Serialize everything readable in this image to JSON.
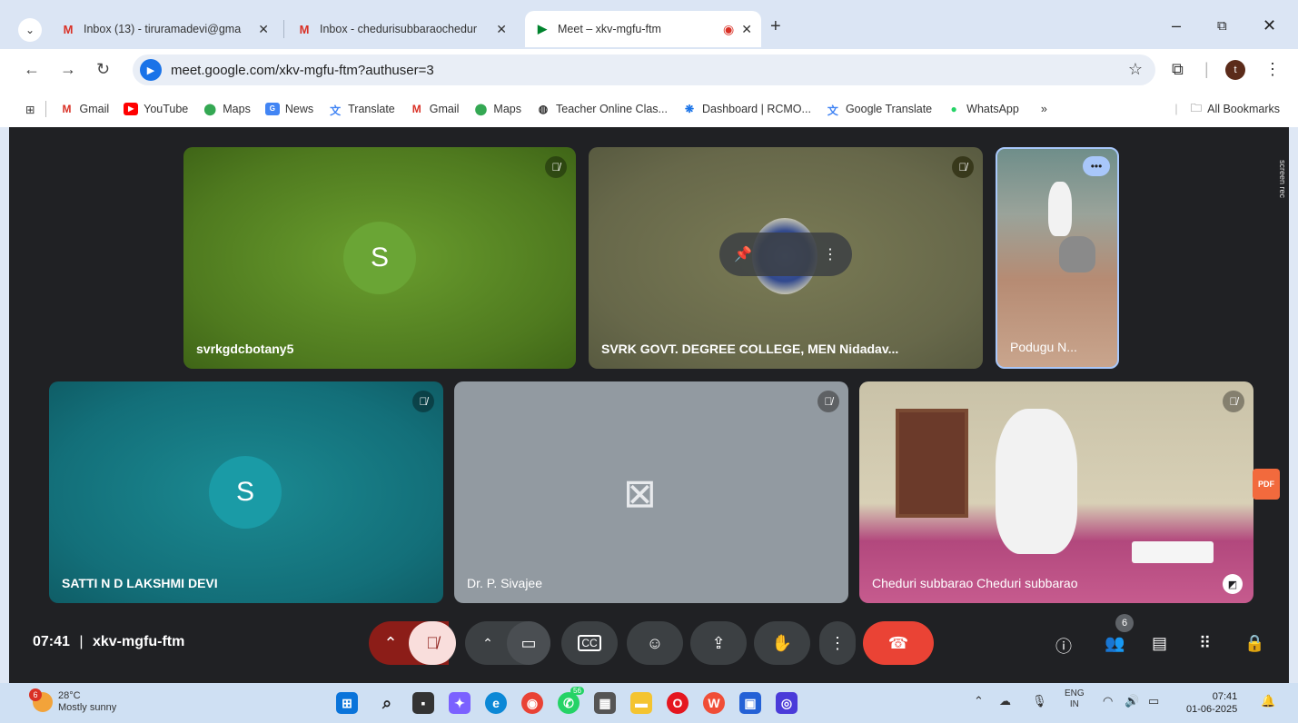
{
  "browser": {
    "tabs": [
      {
        "label": "Inbox (13) - tiruramadevi@gma",
        "icon": "gmail-icon"
      },
      {
        "label": "Inbox - chedurisubbaraochedur",
        "icon": "gmail-icon"
      },
      {
        "label": "Meet – xkv-mgfu-ftm",
        "icon": "meet-icon",
        "active": true
      }
    ],
    "address": "meet.google.com/xkv-mgfu-ftm?authuser=3",
    "profile_initial": "t",
    "bookmarks": [
      {
        "label": "Gmail",
        "icon": "gmail-icon"
      },
      {
        "label": "YouTube",
        "icon": "youtube-icon"
      },
      {
        "label": "Maps",
        "icon": "maps-icon"
      },
      {
        "label": "News",
        "icon": "news-icon"
      },
      {
        "label": "Translate",
        "icon": "translate-icon"
      },
      {
        "label": "Gmail",
        "icon": "gmail-icon"
      },
      {
        "label": "Maps",
        "icon": "maps-icon"
      },
      {
        "label": "Teacher Online Clas...",
        "icon": "globe-icon"
      },
      {
        "label": "Dashboard | RCMO...",
        "icon": "dashboard-icon"
      },
      {
        "label": "Google Translate",
        "icon": "translate-icon"
      },
      {
        "label": "WhatsApp",
        "icon": "whatsapp-icon"
      }
    ],
    "all_bookmarks": "All Bookmarks",
    "more_bookmarks": "»"
  },
  "meet": {
    "tiles": [
      {
        "name": "svrkgdcbotany5",
        "avatar": "S"
      },
      {
        "name": "SVRK GOVT. DEGREE COLLEGE, MEN Nidadav..."
      },
      {
        "name": "Podugu N..."
      },
      {
        "name": "SATTI N D LAKSHMI DEVI",
        "avatar": "S"
      },
      {
        "name": "Dr. P. Sivajee"
      },
      {
        "name": "Cheduri subbarao Cheduri subbarao"
      }
    ],
    "time": "07:41",
    "separator": "|",
    "meeting_code": "xkv-mgfu-ftm",
    "participant_count": "6",
    "screen_rec_label": "screen rec",
    "pdf_label": "PDF"
  },
  "taskbar": {
    "weather_temp": "28°C",
    "weather_desc": "Mostly sunny",
    "weather_badge": "6",
    "lang_top": "ENG",
    "lang_bottom": "IN",
    "time": "07:41",
    "date": "01-06-2025",
    "whatsapp_badge": "56"
  },
  "colors": {
    "meet_bg": "#202124",
    "end_call": "#ea4335",
    "accent": "#1a73e8"
  }
}
